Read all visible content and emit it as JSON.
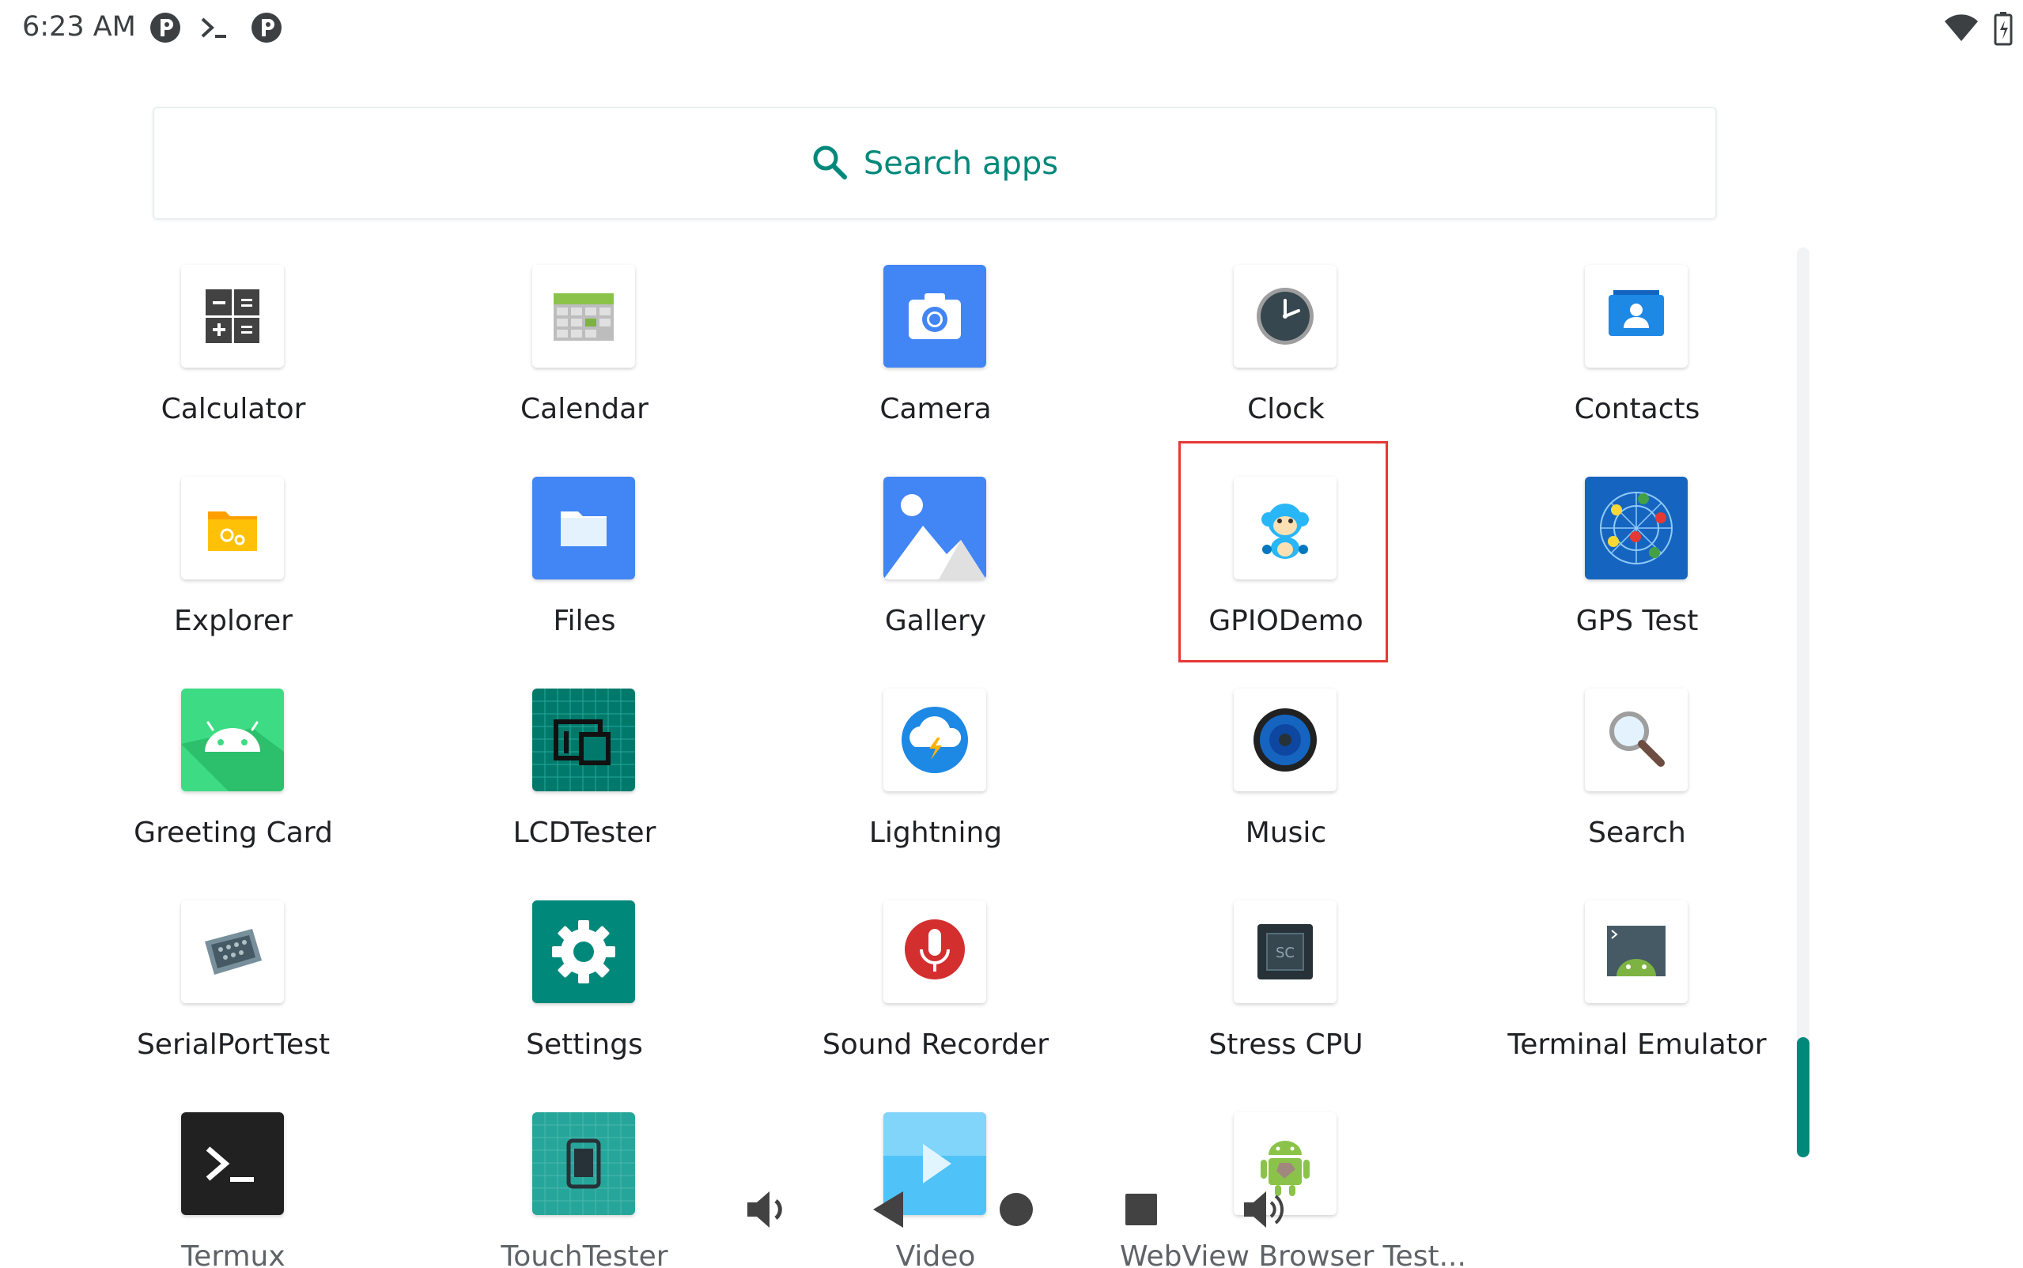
{
  "status_bar": {
    "time": "6:23 AM",
    "left_icons": [
      "pocket-app-icon",
      "terminal-icon",
      "pocket-app-icon"
    ],
    "right_icons": [
      "wifi-icon",
      "battery-icon"
    ]
  },
  "search": {
    "label": "Search apps",
    "icon": "search-icon"
  },
  "apps": [
    {
      "name": "Calculator",
      "icon": "calculator-icon"
    },
    {
      "name": "Calendar",
      "icon": "calendar-icon"
    },
    {
      "name": "Camera",
      "icon": "camera-icon"
    },
    {
      "name": "Clock",
      "icon": "clock-icon"
    },
    {
      "name": "Contacts",
      "icon": "contacts-icon"
    },
    {
      "name": "Explorer",
      "icon": "explorer-icon"
    },
    {
      "name": "Files",
      "icon": "folder-icon"
    },
    {
      "name": "Gallery",
      "icon": "gallery-icon"
    },
    {
      "name": "GPIODemo",
      "icon": "monkey-icon"
    },
    {
      "name": "GPS Test",
      "icon": "gps-test-icon"
    },
    {
      "name": "Greeting Card",
      "icon": "android-icon"
    },
    {
      "name": "LCDTester",
      "icon": "lcd-tester-icon"
    },
    {
      "name": "Lightning",
      "icon": "lightning-icon"
    },
    {
      "name": "Music",
      "icon": "speaker-icon"
    },
    {
      "name": "Search",
      "icon": "magnifier-icon"
    },
    {
      "name": "SerialPortTest",
      "icon": "serial-port-icon"
    },
    {
      "name": "Settings",
      "icon": "gear-icon"
    },
    {
      "name": "Sound Recorder",
      "icon": "microphone-icon"
    },
    {
      "name": "Stress CPU",
      "icon": "cpu-icon"
    },
    {
      "name": "Terminal Emulator",
      "icon": "terminal-emulator-icon"
    },
    {
      "name": "Termux",
      "icon": "termux-icon"
    },
    {
      "name": "TouchTester",
      "icon": "touch-tester-icon"
    },
    {
      "name": "Video",
      "icon": "video-play-icon"
    },
    {
      "name": "WebView Browser Test...",
      "icon": "android-robot-icon"
    }
  ],
  "highlighted_app": "GPIODemo",
  "navigation": [
    "volume-down-icon",
    "back-icon",
    "home-icon",
    "recents-icon",
    "volume-up-icon"
  ],
  "colors": {
    "accent": "#00897b",
    "highlight_border": "#e53935"
  }
}
